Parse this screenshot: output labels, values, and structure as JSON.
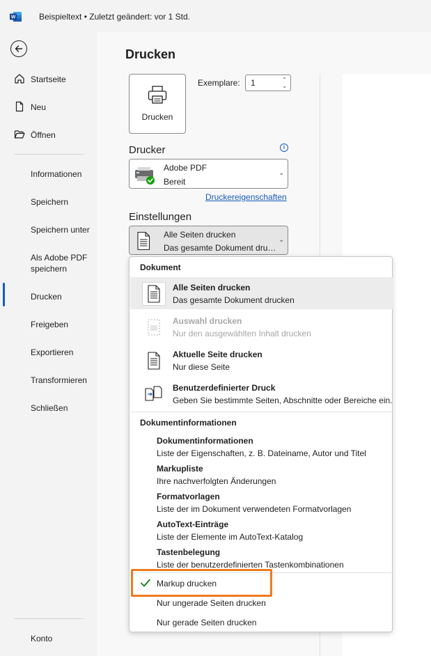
{
  "app": {
    "title": "Beispieltext • Zuletzt geändert: vor 1 Std."
  },
  "sidebar": {
    "top_items": [
      {
        "label": "Startseite",
        "icon": "home-icon"
      },
      {
        "label": "Neu",
        "icon": "new-document-icon"
      },
      {
        "label": "Öffnen",
        "icon": "open-folder-icon"
      }
    ],
    "items": [
      {
        "label": "Informationen"
      },
      {
        "label": "Speichern"
      },
      {
        "label": "Speichern unter"
      },
      {
        "label": "Als Adobe PDF speichern"
      },
      {
        "label": "Drucken",
        "active": true
      },
      {
        "label": "Freigeben"
      },
      {
        "label": "Exportieren"
      },
      {
        "label": "Transformieren"
      },
      {
        "label": "Schließen"
      }
    ],
    "account_label": "Konto"
  },
  "main": {
    "title": "Drucken",
    "print_button_label": "Drucken",
    "copies_label": "Exemplare:",
    "copies_value": "1",
    "printer_heading": "Drucker",
    "printer_name": "Adobe PDF",
    "printer_status": "Bereit",
    "printer_properties_link": "Druckereigenschaften",
    "settings_heading": "Einstellungen",
    "settings_selected_title": "Alle Seiten drucken",
    "settings_selected_desc": "Das gesamte Dokument drucken"
  },
  "menu": {
    "section_document": "Dokument",
    "document_items": [
      {
        "title": "Alle Seiten drucken",
        "desc": "Das gesamte Dokument drucken",
        "icon": "all-pages-icon",
        "highlighted": true,
        "disabled": false
      },
      {
        "title": "Auswahl drucken",
        "desc": "Nur den ausgewählten Inhalt drucken",
        "icon": "selection-icon",
        "highlighted": false,
        "disabled": true
      },
      {
        "title": "Aktuelle Seite drucken",
        "desc": "Nur diese Seite",
        "icon": "current-page-icon",
        "highlighted": false,
        "disabled": false
      },
      {
        "title": "Benutzerdefinierter Druck",
        "desc": "Geben Sie bestimmte Seiten, Abschnitte oder Bereiche ein.",
        "icon": "custom-print-icon",
        "highlighted": false,
        "disabled": false
      }
    ],
    "section_info": "Dokumentinformationen",
    "info_items": [
      {
        "title": "Dokumentinformationen",
        "desc": "Liste der Eigenschaften, z. B. Dateiname, Autor und Titel"
      },
      {
        "title": "Markupliste",
        "desc": "Ihre nachverfolgten Änderungen"
      },
      {
        "title": "Formatvorlagen",
        "desc": "Liste der im Dokument verwendeten Formatvorlagen"
      },
      {
        "title": "AutoText-Einträge",
        "desc": "Liste der Elemente im AutoText-Katalog"
      },
      {
        "title": "Tastenbelegung",
        "desc": "Liste der benutzerdefinierten Tastenkombinationen"
      }
    ],
    "options": [
      {
        "label": "Markup drucken",
        "checked": true
      },
      {
        "label": "Nur ungerade Seiten drucken",
        "checked": false
      },
      {
        "label": "Nur gerade Seiten drucken",
        "checked": false
      }
    ]
  },
  "colors": {
    "accent": "#185abd",
    "highlight_outline": "#f07a1f",
    "check": "#107c10"
  }
}
